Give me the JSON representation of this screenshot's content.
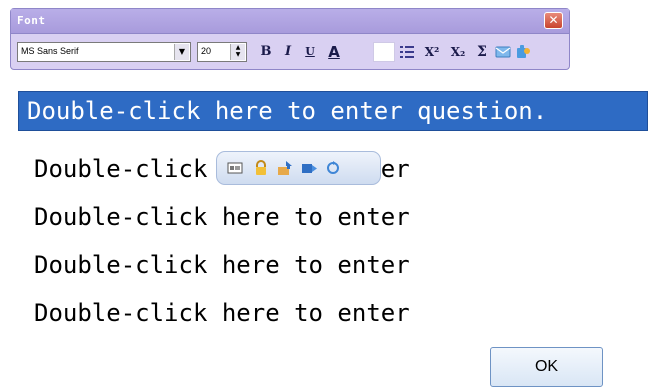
{
  "font_window": {
    "title": "Font",
    "font_name": "MS Sans Serif",
    "font_size": "20",
    "bold_label": "B",
    "italic_label": "I",
    "underline_label": "U",
    "font_color_label": "A",
    "superscript_label": "X²",
    "subscript_label": "X₂",
    "symbol_label": "Σ",
    "icons": [
      "close-icon",
      "dropdown-arrow-icon",
      "spin-icon",
      "bold-icon",
      "italic-icon",
      "underline-icon",
      "font-color-icon",
      "list-icon",
      "superscript-icon",
      "subscript-icon",
      "sigma-icon",
      "message-icon",
      "puzzle-icon"
    ]
  },
  "question": {
    "text": "Double-click here to enter question."
  },
  "answers": [
    {
      "text": "Double-click here to enter"
    },
    {
      "text": "Double-click here to enter"
    },
    {
      "text": "Double-click here to enter"
    },
    {
      "text": "Double-click here to enter"
    }
  ],
  "mini_toolbar": {
    "icons": [
      "image-icon",
      "lock-icon",
      "move-up-icon",
      "move-right-icon",
      "refresh-icon"
    ]
  },
  "ok_label": "OK",
  "colors": {
    "question_bg": "#2e6bc4",
    "toolbar_bg": "#d9d0f2",
    "close_red": "#c8442e"
  }
}
